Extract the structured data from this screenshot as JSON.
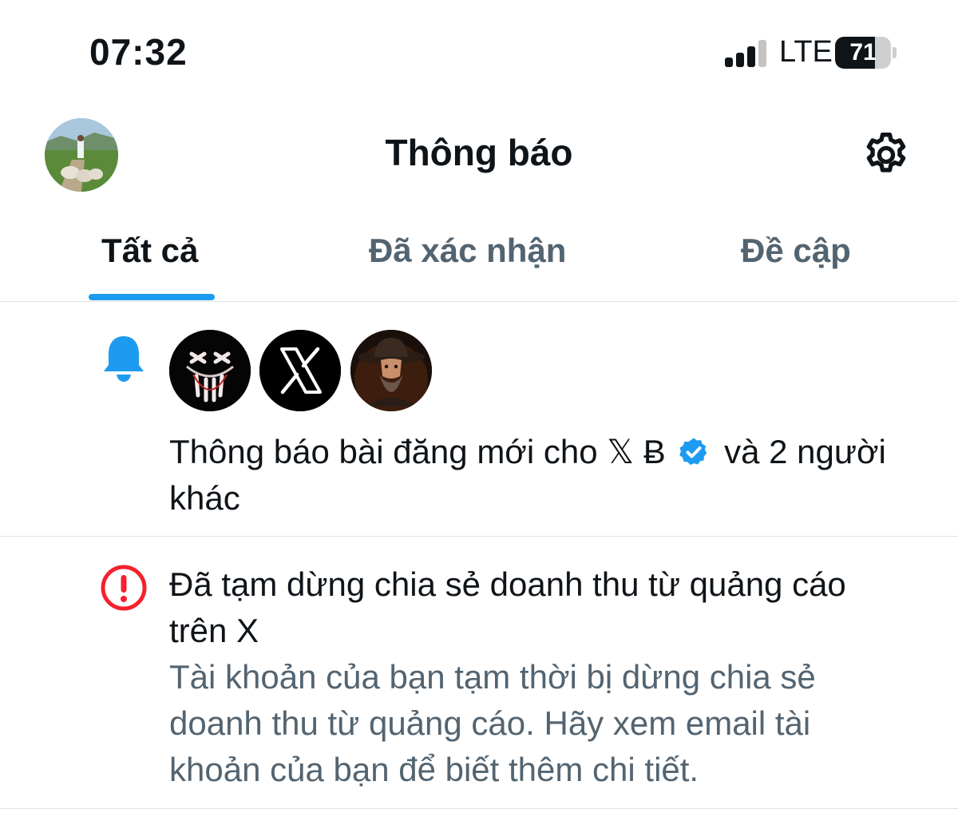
{
  "status_bar": {
    "time": "07:32",
    "network": "LTE",
    "battery": "71",
    "battery_level": 0.71
  },
  "header": {
    "title": "Thông báo",
    "settings_icon": "gear-icon"
  },
  "tabs": [
    {
      "label": "Tất cả",
      "active": true
    },
    {
      "label": "Đã xác nhận",
      "active": false
    },
    {
      "label": "Đề cập",
      "active": false
    }
  ],
  "notifications": [
    {
      "icon": "bell-icon",
      "avatars": [
        "skull-mask-avatar",
        "x-logo-avatar",
        "cowboy-avatar"
      ],
      "text_before": "Thông báo bài đăng mới cho 𝕏 Ƀ",
      "text_after": "và 2 người khác"
    },
    {
      "icon": "alert-circle-icon",
      "title": "Đã tạm dừng chia sẻ doanh thu từ quảng cáo trên X",
      "body": "Tài khoản của bạn tạm thời bị dừng chia sẻ doanh thu từ quảng cáo. Hãy xem email tài khoản của bạn để biết thêm chi tiết."
    }
  ],
  "colors": {
    "accent": "#1d9bf0",
    "alert": "#f4212e",
    "secondary_text": "#536471",
    "divider": "#dfe3e6"
  }
}
